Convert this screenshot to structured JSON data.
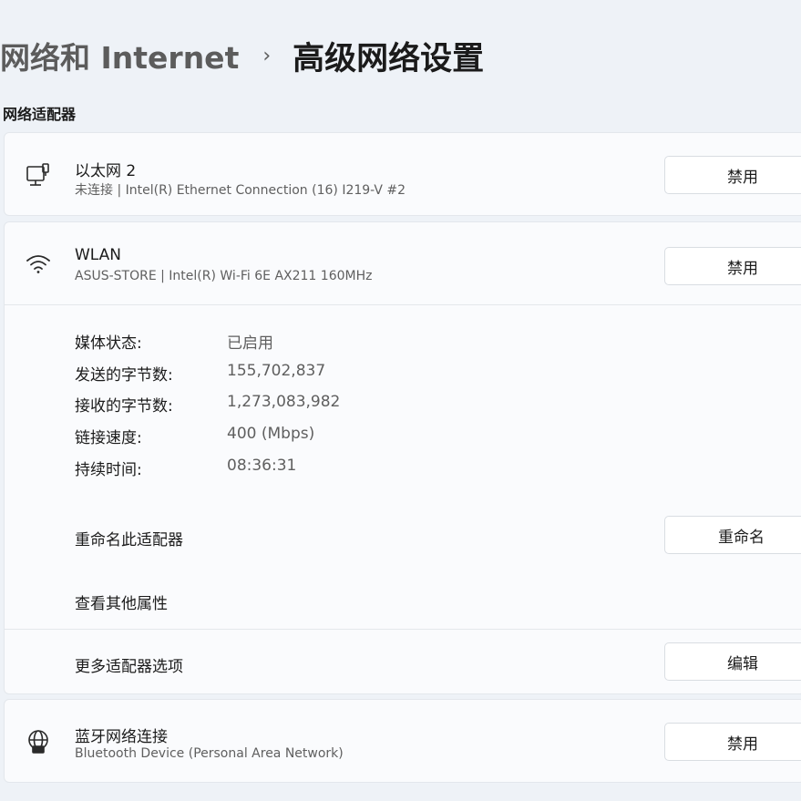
{
  "breadcrumb": {
    "parent": "网络和 Internet",
    "separator": "›",
    "current": "高级网络设置"
  },
  "section_title": "网络适配器",
  "adapters": {
    "ethernet": {
      "icon": "ethernet-icon",
      "name": "以太网 2",
      "description": "未连接 | Intel(R) Ethernet Connection (16) I219-V #2",
      "button": "禁用"
    },
    "wlan": {
      "icon": "wifi-icon",
      "name": "WLAN",
      "description": "ASUS-STORE | Intel(R) Wi-Fi 6E AX211 160MHz",
      "button": "禁用",
      "details": [
        {
          "label": "媒体状态:",
          "value": "已启用"
        },
        {
          "label": "发送的字节数:",
          "value": "155,702,837"
        },
        {
          "label": "接收的字节数:",
          "value": "1,273,083,982"
        },
        {
          "label": "链接速度:",
          "value": "400 (Mbps)"
        },
        {
          "label": "持续时间:",
          "value": "08:36:31"
        }
      ],
      "rename_label": "重命名此适配器",
      "rename_button": "重命名",
      "view_properties": "查看其他属性",
      "more_options_label": "更多适配器选项",
      "more_options_button": "编辑"
    },
    "bluetooth": {
      "icon": "globe-network-icon",
      "name": "蓝牙网络连接",
      "description": "Bluetooth Device (Personal Area Network)",
      "button": "禁用"
    }
  }
}
